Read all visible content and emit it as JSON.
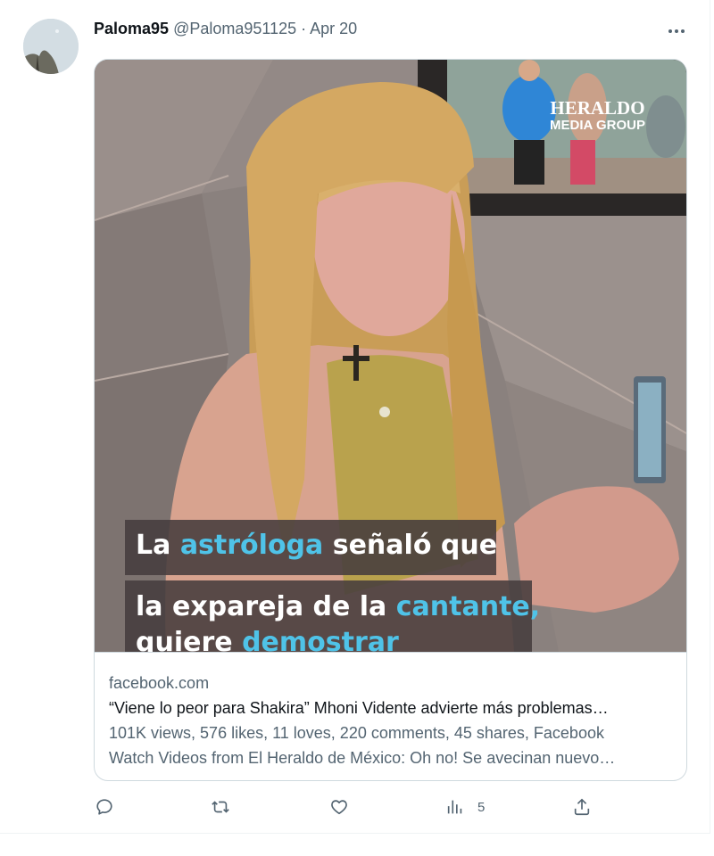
{
  "tweet": {
    "author_name": "Paloma95",
    "author_handle": "@Paloma951125",
    "separator": "·",
    "date": "Apr 20",
    "more_icon": "more-horizontal-icon"
  },
  "media": {
    "watermark_line1": "HERALDO",
    "watermark_line2": "MEDIA GROUP",
    "caption_line1": {
      "pre": "La ",
      "highlight": "astróloga",
      "post": " señaló que"
    },
    "caption_line2": {
      "pre": "la expareja de la ",
      "highlight": "cantante,",
      "post": ""
    },
    "caption_line3": {
      "pre": "quiere ",
      "highlight": "demostrar",
      "post": ""
    },
    "caption_highlight_color": "#4fc3e8"
  },
  "card": {
    "domain": "facebook.com",
    "title": "“Viene lo peor para Shakira” Mhoni Vidente advierte más problemas…",
    "description_line1": "101K views, 576 likes, 11 loves, 220 comments, 45 shares, Facebook",
    "description_line2": "Watch Videos from El Heraldo de México: Oh no! Se avecinan nuevo…"
  },
  "actions": {
    "reply_icon": "reply-icon",
    "retweet_icon": "retweet-icon",
    "like_icon": "heart-icon",
    "views_icon": "analytics-icon",
    "views_count": "5",
    "share_icon": "share-icon"
  }
}
